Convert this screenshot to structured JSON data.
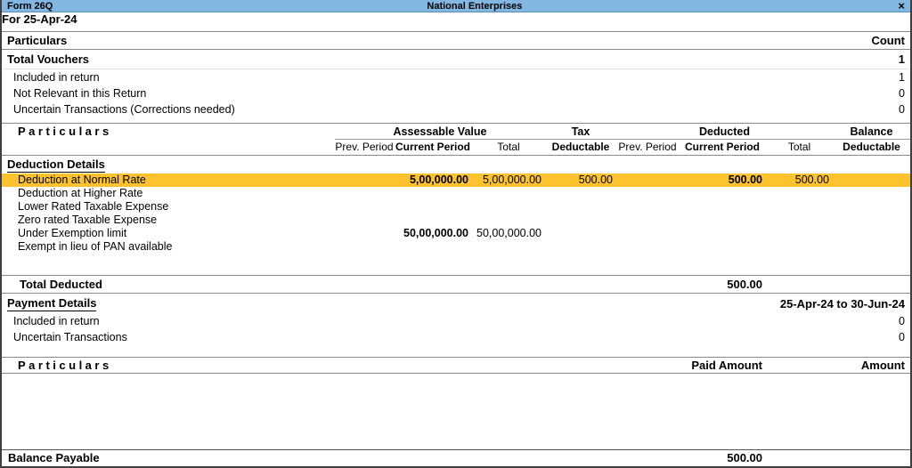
{
  "colors": {
    "titlebar_bg": "#81b7e0",
    "highlight_bg": "#fcc32f"
  },
  "titlebar": {
    "form_label": "Form 26Q",
    "company": "National Enterprises",
    "close_glyph": "×"
  },
  "period_label": "For 25-Apr-24",
  "voucher_summary": {
    "col_particulars": "Particulars",
    "col_count": "Count",
    "total": {
      "label": "Total Vouchers",
      "count": "1"
    },
    "rows": [
      {
        "label": "Included in return",
        "count": "1"
      },
      {
        "label": "Not Relevant in this Return",
        "count": "0"
      },
      {
        "label": "Uncertain Transactions (Corrections needed)",
        "count": "0"
      }
    ]
  },
  "deduction_table": {
    "col_particulars": "Particulars",
    "groups": {
      "assessable": "Assessable Value",
      "tax_line1": "Tax",
      "deducted": "Deducted",
      "balance_line1": "Balance"
    },
    "subcols": {
      "prev_period": "Prev. Period",
      "current_period": "Current Period",
      "total": "Total",
      "deductable": "Deductable"
    },
    "section_title": "Deduction Details",
    "rows": [
      {
        "label": "Deduction at Normal Rate",
        "av_prev": "",
        "av_curr": "5,00,000.00",
        "av_total": "5,00,000.00",
        "tax_ded": "500.00",
        "ded_prev": "",
        "ded_curr": "500.00",
        "ded_total": "500.00",
        "bal": ""
      },
      {
        "label": "Deduction at Higher Rate",
        "av_prev": "",
        "av_curr": "",
        "av_total": "",
        "tax_ded": "",
        "ded_prev": "",
        "ded_curr": "",
        "ded_total": "",
        "bal": ""
      },
      {
        "label": "Lower Rated Taxable Expense",
        "av_prev": "",
        "av_curr": "",
        "av_total": "",
        "tax_ded": "",
        "ded_prev": "",
        "ded_curr": "",
        "ded_total": "",
        "bal": ""
      },
      {
        "label": "Zero rated Taxable Expense",
        "av_prev": "",
        "av_curr": "",
        "av_total": "",
        "tax_ded": "",
        "ded_prev": "",
        "ded_curr": "",
        "ded_total": "",
        "bal": ""
      },
      {
        "label": "Under Exemption limit",
        "av_prev": "",
        "av_curr": "50,00,000.00",
        "av_total": "50,00,000.00",
        "tax_ded": "",
        "ded_prev": "",
        "ded_curr": "",
        "ded_total": "",
        "bal": ""
      },
      {
        "label": "Exempt in lieu of PAN available",
        "av_prev": "",
        "av_curr": "",
        "av_total": "",
        "tax_ded": "",
        "ded_prev": "",
        "ded_curr": "",
        "ded_total": "",
        "bal": ""
      }
    ],
    "total_row": {
      "label": "Total Deducted",
      "ded_curr": "500.00"
    }
  },
  "payment_details": {
    "section_title": "Payment Details",
    "period_range": "25-Apr-24 to 30-Jun-24",
    "rows": [
      {
        "label": "Included in return",
        "amount": "0"
      },
      {
        "label": "Uncertain Transactions",
        "amount": "0"
      }
    ],
    "col_particulars": "Particulars",
    "col_paid_amount": "Paid Amount",
    "col_amount": "Amount",
    "balance_row": {
      "label": "Balance Payable",
      "paid_amount": "500.00"
    }
  }
}
